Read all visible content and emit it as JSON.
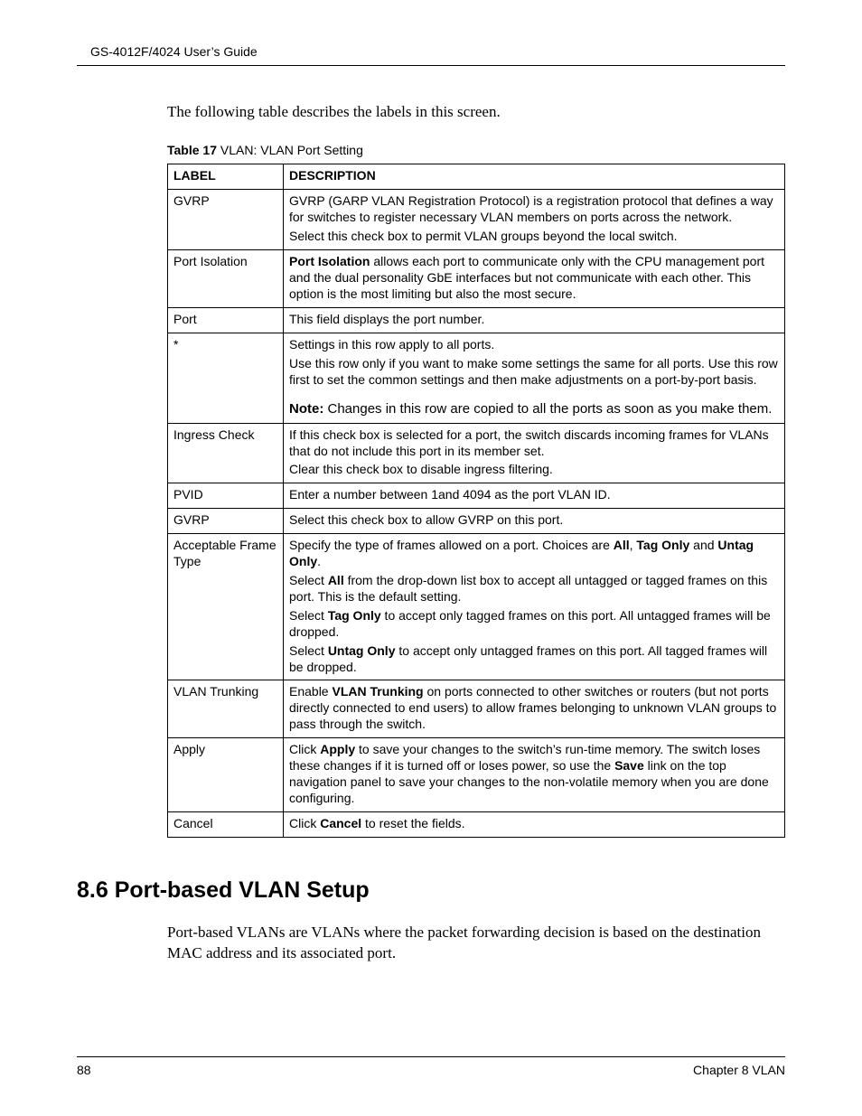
{
  "header": {
    "running": "GS-4012F/4024 User’s Guide"
  },
  "intro": "The following table describes the labels in this screen.",
  "table": {
    "caption_bold": "Table 17",
    "caption_rest": "   VLAN: VLAN Port Setting",
    "head_label": "LABEL",
    "head_desc": "DESCRIPTION",
    "rows": {
      "gvrp1": {
        "label": "GVRP",
        "p1": "GVRP (GARP VLAN Registration Protocol) is a registration protocol that defines a way for switches to register necessary VLAN members on ports across the network.",
        "p2": "Select this check box to permit VLAN groups beyond the local switch."
      },
      "portiso": {
        "label": "Port Isolation",
        "b": "Port Isolation",
        "rest": " allows each port to communicate only with the CPU management port and the dual personality GbE interfaces but not communicate with each other. This option is the most limiting but also the most secure."
      },
      "port": {
        "label": "Port",
        "p1": "This field displays the port number."
      },
      "star": {
        "label": "*",
        "p1": "Settings in this row apply to all ports.",
        "p2": "Use this row only if you want to make some settings the same for all ports. Use this row first to set the common settings and then make adjustments on a port-by-port basis.",
        "note_b": "Note:",
        "note_rest": " Changes in this row are copied to all the ports as soon as you make them."
      },
      "ingress": {
        "label": "Ingress Check",
        "p1": "If this check box is selected for a port, the switch discards incoming frames for VLANs that do not include this port in its member set.",
        "p2": "Clear this check box to disable ingress filtering."
      },
      "pvid": {
        "label": "PVID",
        "p1": "Enter a number between 1and 4094 as the port VLAN ID."
      },
      "gvrp2": {
        "label": "GVRP",
        "p1": "Select this check box to allow GVRP on this port."
      },
      "aft": {
        "label": "Acceptable Frame Type",
        "p1a": "Specify the type of frames allowed on a port. Choices are ",
        "p1b_all": "All",
        "p1c": ", ",
        "p1b_tag": "Tag Only",
        "p1d": " and ",
        "p1b_untag": "Untag Only",
        "p1e": ".",
        "p2a": "Select ",
        "p2b": "All",
        "p2c": " from the drop-down list box to accept all untagged or tagged frames on this port. This is the default setting.",
        "p3a": "Select ",
        "p3b": "Tag Only",
        "p3c": " to accept only tagged frames on this port. All untagged frames will be dropped.",
        "p4a": "Select ",
        "p4b": "Untag Only",
        "p4c": " to accept only untagged frames on this port. All tagged frames will be dropped."
      },
      "trunk": {
        "label": "VLAN Trunking",
        "a": "Enable ",
        "b": "VLAN Trunking",
        "c": " on ports connected to other switches or routers (but not ports directly connected to end users) to allow frames belonging to unknown VLAN groups to pass through the switch."
      },
      "apply": {
        "label": "Apply",
        "a": "Click ",
        "b1": "Apply",
        "c": " to save your changes to the switch’s run-time memory. The switch loses these changes if it is turned off or loses power, so use the ",
        "b2": "Save",
        "d": " link on the top navigation panel to save your changes to the non-volatile memory when you are done configuring."
      },
      "cancel": {
        "label": "Cancel",
        "a": "Click ",
        "b": "Cancel",
        "c": " to reset the fields."
      }
    }
  },
  "section": {
    "num": "8.6  ",
    "title": "Port-based VLAN Setup",
    "body": "Port-based VLANs are VLANs where the packet forwarding decision is based on the destination MAC address and its associated port."
  },
  "footer": {
    "page": "88",
    "chapter": "Chapter 8 VLAN"
  }
}
